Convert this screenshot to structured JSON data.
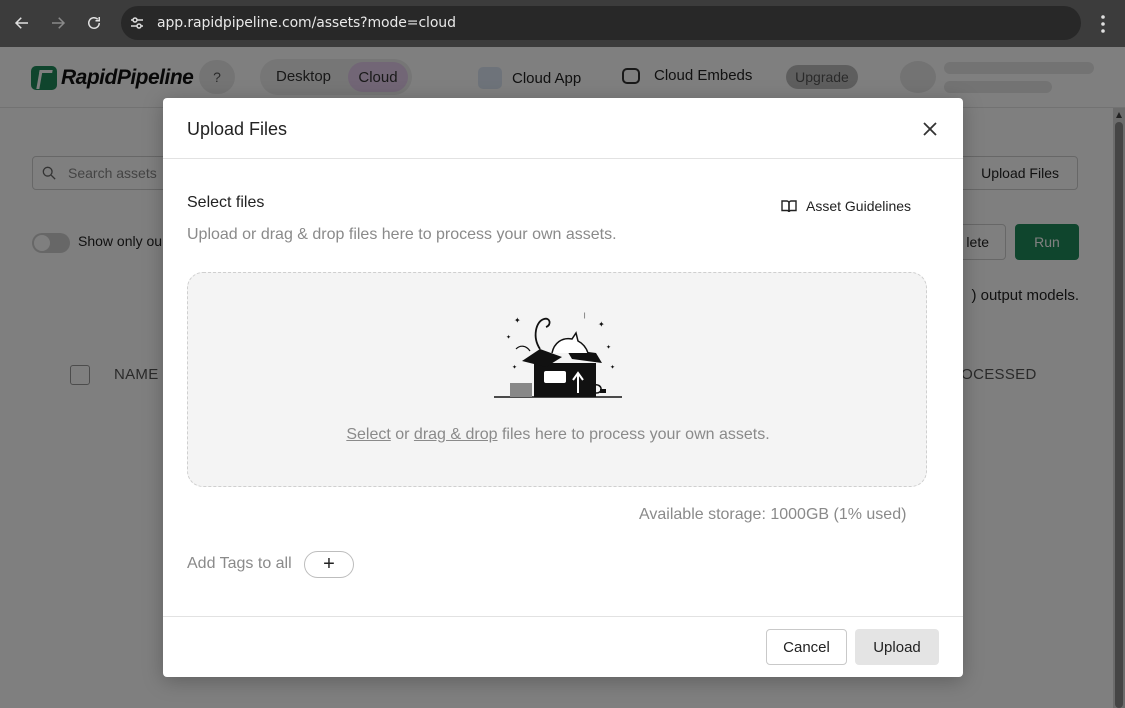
{
  "browser": {
    "url_host": "app.rapidpipeline.com",
    "url_path": "/assets?mode=cloud"
  },
  "header": {
    "logo_text": "RapidPipeline",
    "help_label": "?",
    "mode_desktop": "Desktop",
    "mode_cloud": "Cloud",
    "nav_cloud_app": "Cloud App",
    "nav_cloud_embeds": "Cloud Embeds",
    "upgrade_label": "Upgrade"
  },
  "page": {
    "search_placeholder": "Search assets",
    "upload_files_label": "Upload Files",
    "toggle_label": "Show only ou",
    "delete_label": "lete",
    "run_label": "Run",
    "output_text": ") output models.",
    "col_name": "NAME",
    "col_processed": "ROCESSED"
  },
  "modal": {
    "title": "Upload Files",
    "section_title": "Select files",
    "section_sub": "Upload or drag & drop files here to process your own assets.",
    "guidelines_label": "Asset Guidelines",
    "drop_select": "Select",
    "drop_or": " or ",
    "drop_dragdrop": "drag & drop",
    "drop_rest": " files here to process your own assets.",
    "storage_text": "Available storage: 1000GB (1% used)",
    "tags_label": "Add Tags to all",
    "tags_add": "+",
    "cancel_label": "Cancel",
    "upload_label": "Upload"
  },
  "colors": {
    "brand_green": "#1f8a5a",
    "cloud_pill": "#e4cdec",
    "overlay": "rgba(0,0,0,0.5)"
  }
}
